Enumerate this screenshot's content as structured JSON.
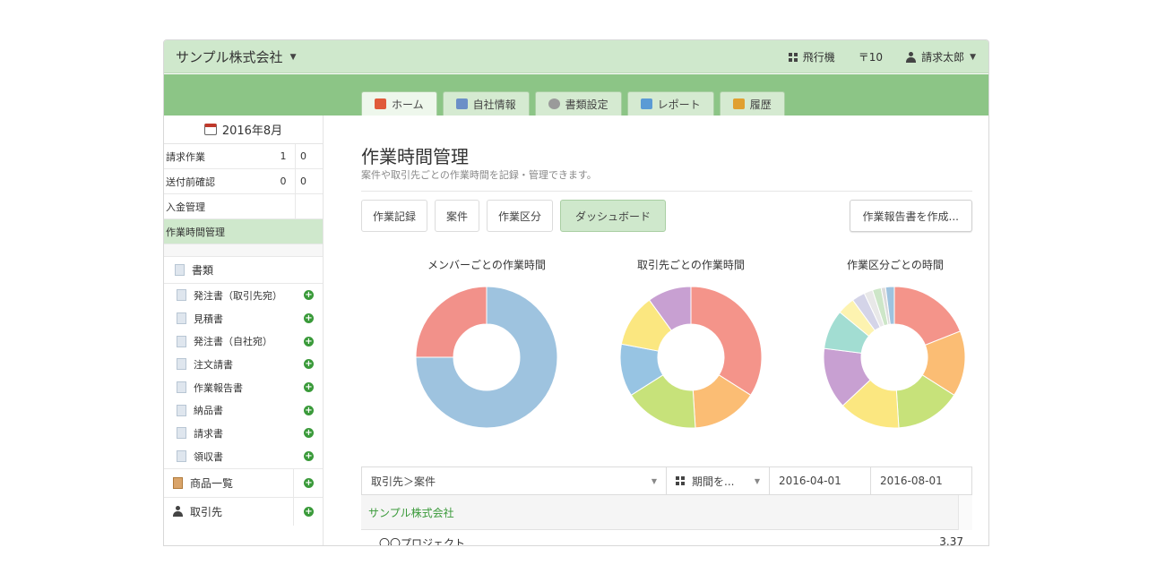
{
  "header": {
    "company": "サンプル株式会社",
    "right_items": [
      {
        "icon": "grid-icon",
        "label": "飛行機"
      },
      {
        "icon": "inbox-icon",
        "label": "〒10"
      },
      {
        "icon": "user-icon",
        "label": "請求太郎"
      }
    ]
  },
  "nav": {
    "tabs": [
      {
        "label": "ホーム",
        "icon": "home-icon",
        "color": "#e05a3a"
      },
      {
        "label": "自社情報",
        "icon": "building-icon",
        "color": "#6b8fc7"
      },
      {
        "label": "書類設定",
        "icon": "gear-icon",
        "color": "#9a9a9a"
      },
      {
        "label": "レポート",
        "icon": "chart-icon",
        "color": "#5b9bd5"
      },
      {
        "label": "履歴",
        "icon": "history-icon",
        "color": "#e0a030"
      }
    ]
  },
  "sidebar": {
    "month": "2016年8月",
    "tasks": [
      {
        "label": "請求作業",
        "count": "1 0"
      },
      {
        "label": "送付前確認",
        "count": "0 0"
      },
      {
        "label": "入金管理",
        "count": ""
      },
      {
        "label": "作業時間管理",
        "count": ""
      }
    ],
    "docs_header": "書類",
    "docs": [
      "発注書（取引先宛）",
      "見積書",
      "発注書（自社宛）",
      "注文請書",
      "作業報告書",
      "納品書",
      "請求書",
      "領収書"
    ],
    "products": "商品一覧",
    "clients": "取引先"
  },
  "main": {
    "title": "作業時間管理",
    "subtitle": "案件や取引先ごとの作業時間を記録・管理できます。",
    "buttons": [
      "作業記録",
      "案件",
      "作業区分",
      "ダッシュボード"
    ],
    "report_button": "作業報告書を作成...",
    "charts": [
      {
        "title": "メンバーごとの作業時間"
      },
      {
        "title": "取引先ごとの作業時間"
      },
      {
        "title": "作業区分ごとの時間"
      }
    ],
    "filter": {
      "group_by": "取引先＞案件",
      "period": "期間を...",
      "date_from": "2016-04-01",
      "date_to": "2016-08-01"
    },
    "table": {
      "group": "サンプル株式会社",
      "rows": [
        {
          "name": "〇〇プロジェクト",
          "value": "3.37"
        }
      ]
    }
  },
  "chart_data": [
    {
      "type": "pie",
      "title": "メンバーごとの作業時間",
      "values": [
        75,
        25
      ],
      "colors": [
        "#9ec3df",
        "#f2918a"
      ]
    },
    {
      "type": "pie",
      "title": "取引先ごとの作業時間",
      "values": [
        34,
        15,
        17,
        12,
        12,
        10
      ],
      "colors": [
        "#f4948a",
        "#fbbd74",
        "#c7e27a",
        "#97c4e3",
        "#fbe780",
        "#c8a0d2"
      ]
    },
    {
      "type": "pie",
      "title": "作業区分ごとの時間",
      "values": [
        19,
        15,
        15,
        14,
        14,
        9,
        4,
        3,
        2,
        2,
        1,
        2
      ],
      "colors": [
        "#f4948a",
        "#fbbd74",
        "#c7e27a",
        "#fbe780",
        "#c8a0d2",
        "#a2ddd2",
        "#fdf3b0",
        "#d4d4e8",
        "#e8e8e8",
        "#cde6c8",
        "#dcdcdc",
        "#9ec3df"
      ]
    }
  ]
}
